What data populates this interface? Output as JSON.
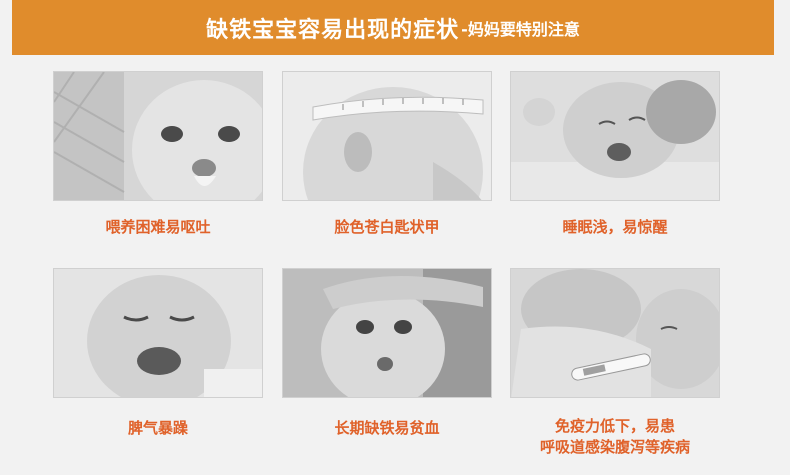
{
  "header": {
    "title": "缺铁宝宝容易出现的症状",
    "subtitle": "-妈妈要特别注意",
    "bg_color": "#e08c2c"
  },
  "symptoms": [
    {
      "caption": "喂养困难易呕吐",
      "image": "baby-drooling-photo"
    },
    {
      "caption": "脸色苍白匙状甲",
      "image": "baby-head-measuring-tape-photo"
    },
    {
      "caption": "睡眠浅，易惊醒",
      "image": "baby-crying-in-bed-photo"
    },
    {
      "caption": "脾气暴躁",
      "image": "baby-crying-photo"
    },
    {
      "caption": "长期缺铁易贫血",
      "image": "baby-forehead-touched-photo"
    },
    {
      "caption_line1": "免疫力低下，易患",
      "caption_line2": "呼吸道感染腹泻等疾病",
      "image": "baby-thermometer-photo"
    }
  ],
  "caption_color": "#e0622a"
}
